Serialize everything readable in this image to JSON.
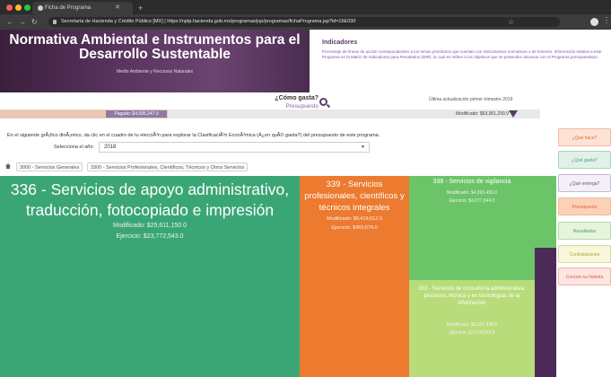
{
  "browser": {
    "tab_title": "Ficha de Programa",
    "url": "Secretaría de Hacienda y Crédito Público [MX]  |  https://nptp.hacienda.gob.mx/programas/jsp/programas/fichaPrograma.jsp?id=16E030",
    "colors": {
      "close": "#ff5f57",
      "minimize": "#febc2e",
      "maximize": "#28c840"
    }
  },
  "header": {
    "title": "Normativa Ambiental e Instrumentos para el Desarrollo Sustentable",
    "subtitle": "Medio Ambiente y Recursos Naturales"
  },
  "indicators": {
    "title": "Indicadores",
    "text": "Porcentaje de líneas de acción correspondientes a los temas prioritarios que cuentan con instrumentos normativos o de fomento. Información relativa a este Programa en la Matriz de Indicadores para Resultados (MIR), la cual se refiere a los objetivos que se pretenden alcanzar con el Programa presupuestario."
  },
  "question": {
    "main": "¿Cómo gasta?",
    "sub": "Presupuesto"
  },
  "last_update": "Última actualización primer trimestre 2019",
  "progress": {
    "paid_label": "Pagado: $4,095,247.9",
    "modified_label": "Modificado: $63,901,299.9",
    "fraction": 0.31
  },
  "instruction": "En el siguiente grÃ¡fico dinÃ¡mico, da clic en el cuadro de tu elecciÃ³n para explorar la ClasificaciÃ³n EconÃ³mica (Â¿en quÃ© gasta?) del presupuesto de este programa.",
  "year": {
    "label": "Selecciona el año:",
    "value": "2018"
  },
  "breadcrumb": [
    "3000 - Servicios Generales",
    "3300 - Servicios Profesionales, Científicos, Técnicos y Otros Servicios"
  ],
  "treemap": [
    {
      "title": "336 - Servicios de apoyo administrativo, traducción, fotocopiado e impresión",
      "modificado": "Modificado: $25,611,150.0",
      "ejercicio": "Ejercicio: $23,772,543.0",
      "color": "#3aa676"
    },
    {
      "title": "339 - Servicios profesionales, científicos y técnicos integrales",
      "modificado": "Modificado: $9,419,612.0",
      "ejercicio": "Ejercicio: $469,574.0",
      "color": "#ec7a2f"
    },
    {
      "title": "338 - Servicios de vigilancia",
      "modificado": "Modificado: $4,693,450.0",
      "ejercicio": "Ejercicio: $4,077,844.0",
      "color": "#6cc468"
    },
    {
      "title": "333 - Servicios de consultoría administrativa, procesos, técnica y en tecnologías de la información",
      "modificado": "Modificado: $3,207,436.9",
      "ejercicio": "Ejercicio: $3,174,973.5",
      "color": "#b9dc7a"
    }
  ],
  "side_menu": [
    {
      "label": "¿Qué hace?",
      "bg": "#fde3d6",
      "fg": "#e06a2a",
      "border": "#f5b797"
    },
    {
      "label": "¿Qué gasta?",
      "bg": "#e2f1e8",
      "fg": "#3aa676",
      "border": "#a6d6bb"
    },
    {
      "label": "¿Qué entrega?",
      "bg": "#f4f0f8",
      "fg": "#6b4d85",
      "border": "#c9b9d9"
    },
    {
      "label": "Presupuesto",
      "bg": "#fcd1b9",
      "fg": "#e06a2a",
      "border": "#f5b797"
    },
    {
      "label": "Resultados",
      "bg": "#e6f4df",
      "fg": "#4c9a4a",
      "border": "#b6dca3"
    },
    {
      "label": "Contrataciones",
      "bg": "#f7f7dc",
      "fg": "#b5a12a",
      "border": "#dcd79a"
    },
    {
      "label": "Conoce su historia",
      "bg": "#fde6e2",
      "fg": "#e0553a",
      "border": "#f5b4a3"
    }
  ]
}
